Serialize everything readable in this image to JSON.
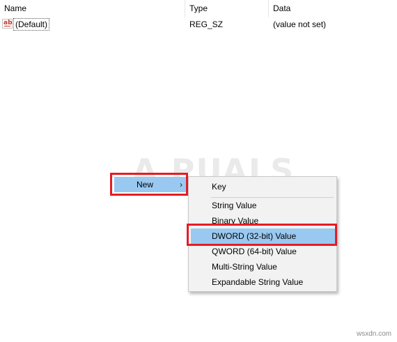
{
  "columns": {
    "name": "Name",
    "type": "Type",
    "data": "Data"
  },
  "rows": [
    {
      "icon": "ab",
      "name": "(Default)",
      "type": "REG_SZ",
      "data": "(value not set)"
    }
  ],
  "context_menu": {
    "new_label": "New"
  },
  "submenu": {
    "items": [
      {
        "label": "Key"
      },
      {
        "label": "String Value"
      },
      {
        "label": "Binary Value"
      },
      {
        "label": "DWORD (32-bit) Value",
        "selected": true
      },
      {
        "label": "QWORD (64-bit) Value"
      },
      {
        "label": "Multi-String Value"
      },
      {
        "label": "Expandable String Value"
      }
    ]
  },
  "watermark": "A  PUALS",
  "site_mark": "wsxdn.com",
  "colors": {
    "highlight_border": "#e51c24",
    "selection": "#99c9f1",
    "menu_bg": "#f2f2f2"
  }
}
